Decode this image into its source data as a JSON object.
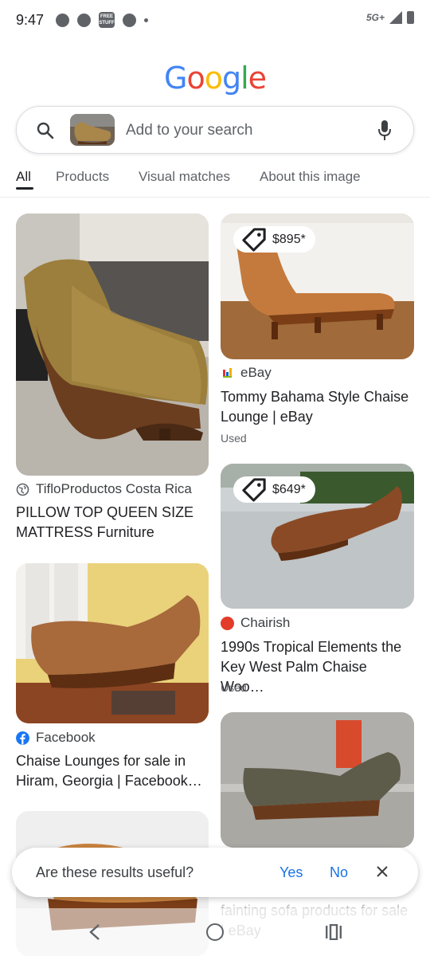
{
  "status_bar": {
    "time": "9:47",
    "network": "5G+",
    "free_icon_text": "FREE STUFF"
  },
  "logo": {
    "text": "Google",
    "letters": [
      "G",
      "o",
      "o",
      "g",
      "l",
      "e"
    ]
  },
  "search": {
    "placeholder": "Add to your search"
  },
  "tabs": [
    {
      "label": "All",
      "active": true
    },
    {
      "label": "Products",
      "active": false
    },
    {
      "label": "Visual matches",
      "active": false
    },
    {
      "label": "About this image",
      "active": false
    }
  ],
  "results": [
    {
      "source": "TifloProductos Costa Rica",
      "title": "PILLOW TOP QUEEN SIZE MATTRESS Furniture"
    },
    {
      "source": "eBay",
      "price": "$895*",
      "title": "Tommy Bahama Style Chaise Lounge | eBay",
      "condition": "Used"
    },
    {
      "source": "Chairish",
      "price": "$649*",
      "title": "1990s Tropical Elements the Key West Palm Chaise Woo…",
      "condition": "Used"
    },
    {
      "source": "Facebook",
      "title": "Chaise Lounges for sale in Hiram, Georgia | Facebook…"
    },
    {
      "title": "fainting sofa products for sale | eBay"
    }
  ],
  "feedback": {
    "question": "Are these results useful?",
    "yes": "Yes",
    "no": "No"
  },
  "colors": {
    "link_blue": "#1a73e8",
    "ebay_blue": "#3665f3",
    "chairish_red": "#e23c2a",
    "facebook_blue": "#1877f2"
  }
}
